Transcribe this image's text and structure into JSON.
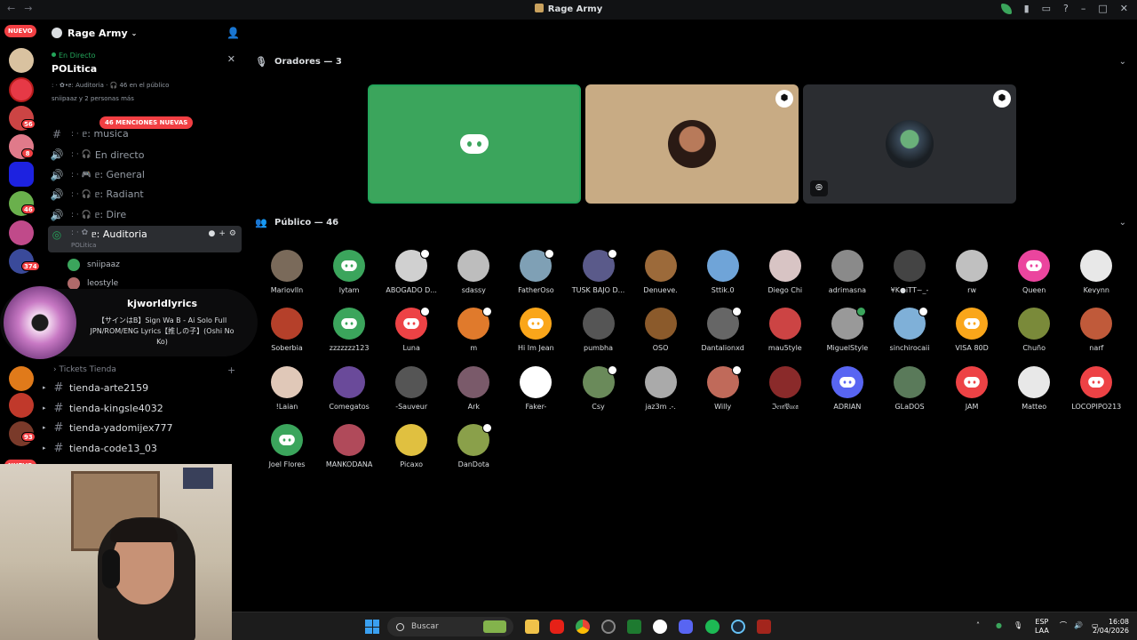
{
  "window": {
    "title": "Rage Army"
  },
  "server": {
    "name": "Rage Army"
  },
  "live": {
    "label": "En Directo",
    "title": "POLitica",
    "detail": ": · ✿•ᥱ: Auditoria · 🎧 46 en el público",
    "listeners": "sniipaaz y 2 personas más"
  },
  "sidebar": {
    "mentions": "46 MENCIONES NUEVAS",
    "channels": [
      {
        "name": "ᥱ: musica",
        "prefix": ": ·"
      },
      {
        "name": "En directo",
        "prefix": ": · 🎧"
      },
      {
        "name": "ᥱ: General",
        "prefix": ": · 🎮"
      },
      {
        "name": "ᥱ: Radiant",
        "prefix": ": · 🎧"
      },
      {
        "name": "ᥱ: Dire",
        "prefix": ": · 🎧"
      },
      {
        "name": "ᥱ: Auditoria",
        "prefix": ": · ✿",
        "sub": "POLitica"
      }
    ],
    "members": [
      "sniipaaz",
      "leostyle"
    ],
    "category": "Tickets Tienda",
    "text_channels": [
      "tienda-arte2159",
      "tienda-kingsle4032",
      "tienda-yadomijex777",
      "tienda-code13_03"
    ]
  },
  "guilds": {
    "badges": [
      "56",
      "8",
      "46",
      "374",
      "93"
    ],
    "nuevo": "NUEVO"
  },
  "now_playing": {
    "user": "kjworldlyrics",
    "song": "【サインはB】Sign Wa B - Ai Solo Full JPN/ROM/ENG Lyrics【推しの子】(Oshi No Ko)"
  },
  "stage": {
    "speakers_header": "Oradores — 3",
    "audience_header": "Público — 46",
    "audience": [
      {
        "name": "Mariovlln",
        "color": "#7a6a5a",
        "logo": ""
      },
      {
        "name": "lytam",
        "color": "#3ba55c",
        "logo": "g"
      },
      {
        "name": "ABOGADO D...",
        "color": "#d0d0d0",
        "logo": "",
        "badge": true
      },
      {
        "name": "sdassy",
        "color": "#bdbdbd",
        "logo": ""
      },
      {
        "name": "FatherOso",
        "color": "#7fa0b5",
        "logo": "",
        "badge": true
      },
      {
        "name": "TUSK BAJO D...",
        "color": "#5a5a8a",
        "logo": "",
        "badge": true
      },
      {
        "name": "Denueve.",
        "color": "#9c6a3a",
        "logo": ""
      },
      {
        "name": "Sttik.0",
        "color": "#6fa4d8",
        "logo": ""
      },
      {
        "name": "Diego Chi",
        "color": "#d8c4c4",
        "logo": ""
      },
      {
        "name": "adrimasna",
        "color": "#8a8a8a",
        "logo": ""
      },
      {
        "name": "¥K●iTT~_-",
        "color": "#444",
        "logo": ""
      },
      {
        "name": "rw",
        "color": "#c0c0c0",
        "logo": ""
      },
      {
        "name": "Queen",
        "color": "#eb459e",
        "logo": "p"
      },
      {
        "name": "Kevynn",
        "color": "#e8e8e8",
        "logo": ""
      },
      {
        "name": "Soberbia",
        "color": "#b5402a",
        "logo": ""
      },
      {
        "name": "zzzzzzz123",
        "color": "#3ba55c",
        "logo": "g"
      },
      {
        "name": "Luna",
        "color": "#ed4245",
        "logo": "r",
        "badge": true
      },
      {
        "name": "m",
        "color": "#e07a2c",
        "logo": "",
        "badge": true
      },
      {
        "name": "Hi Im Jean",
        "color": "#faa61a",
        "logo": "o"
      },
      {
        "name": "pumbha",
        "color": "#555",
        "logo": ""
      },
      {
        "name": "OSO",
        "color": "#8b5a2b",
        "logo": ""
      },
      {
        "name": "Dantalionxd",
        "color": "#666",
        "logo": "",
        "badge": true
      },
      {
        "name": "mau5tyle",
        "color": "#c44",
        "logo": ""
      },
      {
        "name": "MiguelStyle",
        "color": "#999",
        "logo": "",
        "badge": true,
        "badge_green": true
      },
      {
        "name": "sinchirocaii",
        "color": "#7fb0d8",
        "logo": "",
        "badge": true
      },
      {
        "name": "VISA 80D",
        "color": "#faa61a",
        "logo": "o"
      },
      {
        "name": "Chuño",
        "color": "#7a8a3a",
        "logo": ""
      },
      {
        "name": "narf",
        "color": "#c05a3a",
        "logo": ""
      },
      {
        "name": "!Laian",
        "color": "#e0c8b8",
        "logo": ""
      },
      {
        "name": "Comegatos",
        "color": "#6a4a9a",
        "logo": ""
      },
      {
        "name": "-Sauveur",
        "color": "#555",
        "logo": ""
      },
      {
        "name": "Ark",
        "color": "#7a5a6a",
        "logo": ""
      },
      {
        "name": "Faker-",
        "color": "#ffffff",
        "logo": ""
      },
      {
        "name": "Csy",
        "color": "#6a8a5a",
        "logo": "",
        "badge": true
      },
      {
        "name": "jaz3m .-.",
        "color": "#aaa",
        "logo": ""
      },
      {
        "name": "Willy",
        "color": "#c06a5a",
        "logo": "",
        "badge": true
      },
      {
        "name": "ℑ𝔢𝔪𝔓𝔲𝔠𝔞",
        "color": "#8a2a2a",
        "logo": ""
      },
      {
        "name": "ADRIAN",
        "color": "#5865f2",
        "logo": "b"
      },
      {
        "name": "GLaDOS",
        "color": "#5a7a5a",
        "logo": ""
      },
      {
        "name": "JAM",
        "color": "#ed4245",
        "logo": "r"
      },
      {
        "name": "Matteo",
        "color": "#e8e8e8",
        "logo": ""
      },
      {
        "name": "LOCOPIPO213",
        "color": "#ed4245",
        "logo": "r"
      },
      {
        "name": "Joel Flores",
        "color": "#3ba55c",
        "logo": "g"
      },
      {
        "name": "MANKODANA",
        "color": "#b04a5a",
        "logo": ""
      },
      {
        "name": "Picaxo",
        "color": "#e0c040",
        "logo": ""
      },
      {
        "name": "DanDota",
        "color": "#8aa04a",
        "logo": "",
        "badge": true
      }
    ]
  },
  "taskbar": {
    "search_placeholder": "Buscar",
    "lang": "ESP",
    "lang2": "LAA",
    "time": "16:08",
    "date": "2/04/2026"
  },
  "colors": {
    "accent_green": "#3ba55c",
    "stage_bg": "#000000",
    "tile_tan": "#c8ab84",
    "tile_dark": "#2b2d31"
  }
}
